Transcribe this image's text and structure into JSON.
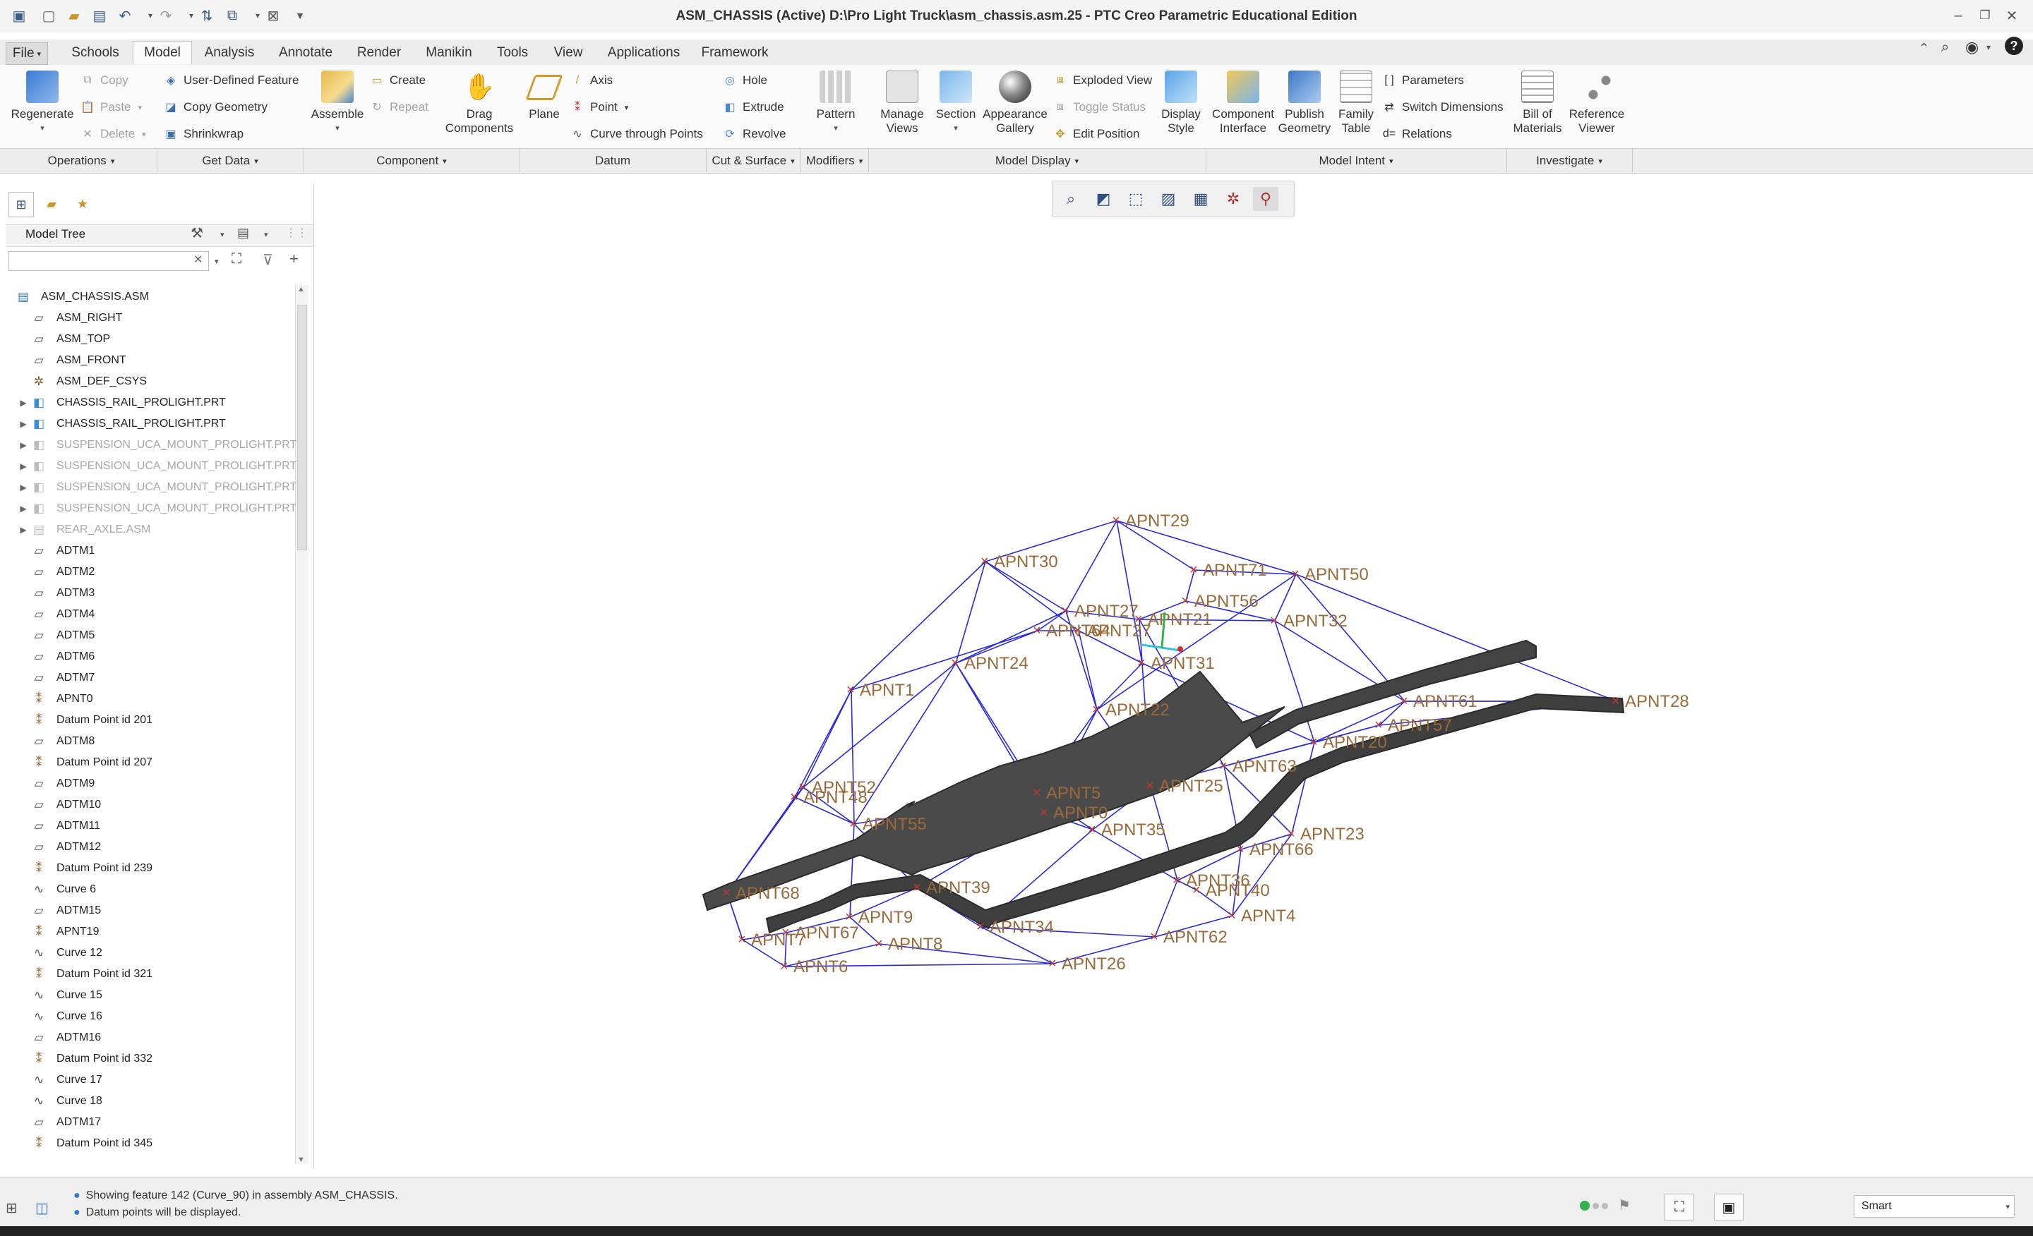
{
  "window": {
    "title": "ASM_CHASSIS (Active) D:\\Pro Light Truck\\asm_chassis.asm.25 - PTC Creo Parametric Educational Edition"
  },
  "tabs": [
    "File",
    "Schools",
    "Model",
    "Analysis",
    "Annotate",
    "Render",
    "Manikin",
    "Tools",
    "View",
    "Applications",
    "Framework"
  ],
  "active_tab": "Model",
  "ribbon": {
    "regenerate": "Regenerate",
    "copy": "Copy",
    "paste": "Paste",
    "delete": "Delete",
    "user_defined_feature": "User-Defined Feature",
    "copy_geometry": "Copy Geometry",
    "shrinkwrap": "Shrinkwrap",
    "assemble": "Assemble",
    "create": "Create",
    "repeat": "Repeat",
    "drag_components_1": "Drag",
    "drag_components_2": "Components",
    "plane": "Plane",
    "axis": "Axis",
    "point": "Point",
    "curve_through_points": "Curve through Points",
    "hole": "Hole",
    "extrude": "Extrude",
    "revolve": "Revolve",
    "pattern": "Pattern",
    "manage_views_1": "Manage",
    "manage_views_2": "Views",
    "section": "Section",
    "appearance_gallery_1": "Appearance",
    "appearance_gallery_2": "Gallery",
    "exploded_view": "Exploded View",
    "toggle_status": "Toggle Status",
    "edit_position": "Edit Position",
    "display_style_1": "Display",
    "display_style_2": "Style",
    "component_interface_1": "Component",
    "component_interface_2": "Interface",
    "publish_geometry_1": "Publish",
    "publish_geometry_2": "Geometry",
    "family_table_1": "Family",
    "family_table_2": "Table",
    "parameters": "Parameters",
    "switch_dimensions": "Switch Dimensions",
    "relations": "Relations",
    "bill_of_materials_1": "Bill of",
    "bill_of_materials_2": "Materials",
    "reference_viewer_1": "Reference",
    "reference_viewer_2": "Viewer",
    "groups": [
      "Operations",
      "Get Data",
      "Component",
      "Datum",
      "Cut & Surface",
      "Modifiers",
      "Model Display",
      "Model Intent",
      "Investigate"
    ]
  },
  "model_tree": {
    "title": "Model Tree",
    "search_placeholder": "",
    "items": [
      {
        "label": "ASM_CHASSIS.ASM",
        "icon": "assembly-icon",
        "expandable": false,
        "greyed": false,
        "root": true
      },
      {
        "label": "ASM_RIGHT",
        "icon": "datum-plane-icon",
        "expandable": false,
        "greyed": false
      },
      {
        "label": "ASM_TOP",
        "icon": "datum-plane-icon",
        "expandable": false,
        "greyed": false
      },
      {
        "label": "ASM_FRONT",
        "icon": "datum-plane-icon",
        "expandable": false,
        "greyed": false
      },
      {
        "label": "ASM_DEF_CSYS",
        "icon": "csys-icon",
        "expandable": false,
        "greyed": false
      },
      {
        "label": "CHASSIS_RAIL_PROLIGHT.PRT",
        "icon": "part-icon",
        "expandable": true,
        "greyed": false
      },
      {
        "label": "CHASSIS_RAIL_PROLIGHT.PRT",
        "icon": "part-icon",
        "expandable": true,
        "greyed": false
      },
      {
        "label": "SUSPENSION_UCA_MOUNT_PROLIGHT.PRT",
        "icon": "part-icon",
        "expandable": true,
        "greyed": true
      },
      {
        "label": "SUSPENSION_UCA_MOUNT_PROLIGHT.PRT",
        "icon": "part-icon",
        "expandable": true,
        "greyed": true
      },
      {
        "label": "SUSPENSION_UCA_MOUNT_PROLIGHT.PRT",
        "icon": "part-icon",
        "expandable": true,
        "greyed": true
      },
      {
        "label": "SUSPENSION_UCA_MOUNT_PROLIGHT.PRT",
        "icon": "part-icon",
        "expandable": true,
        "greyed": true
      },
      {
        "label": "REAR_AXLE.ASM",
        "icon": "assembly-icon",
        "expandable": true,
        "greyed": true
      },
      {
        "label": "ADTM1",
        "icon": "datum-plane-icon",
        "expandable": false,
        "greyed": false
      },
      {
        "label": "ADTM2",
        "icon": "datum-plane-icon",
        "expandable": false,
        "greyed": false
      },
      {
        "label": "ADTM3",
        "icon": "datum-plane-icon",
        "expandable": false,
        "greyed": false
      },
      {
        "label": "ADTM4",
        "icon": "datum-plane-icon",
        "expandable": false,
        "greyed": false
      },
      {
        "label": "ADTM5",
        "icon": "datum-plane-icon",
        "expandable": false,
        "greyed": false
      },
      {
        "label": "ADTM6",
        "icon": "datum-plane-icon",
        "expandable": false,
        "greyed": false
      },
      {
        "label": "ADTM7",
        "icon": "datum-plane-icon",
        "expandable": false,
        "greyed": false
      },
      {
        "label": "APNT0",
        "icon": "datum-point-icon",
        "expandable": false,
        "greyed": false
      },
      {
        "label": "Datum Point id 201",
        "icon": "datum-point-icon",
        "expandable": false,
        "greyed": false
      },
      {
        "label": "ADTM8",
        "icon": "datum-plane-icon",
        "expandable": false,
        "greyed": false
      },
      {
        "label": "Datum Point id 207",
        "icon": "datum-point-icon",
        "expandable": false,
        "greyed": false
      },
      {
        "label": "ADTM9",
        "icon": "datum-plane-icon",
        "expandable": false,
        "greyed": false
      },
      {
        "label": "ADTM10",
        "icon": "datum-plane-icon",
        "expandable": false,
        "greyed": false
      },
      {
        "label": "ADTM11",
        "icon": "datum-plane-icon",
        "expandable": false,
        "greyed": false
      },
      {
        "label": "ADTM12",
        "icon": "datum-plane-icon",
        "expandable": false,
        "greyed": false
      },
      {
        "label": "Datum Point id 239",
        "icon": "datum-point-icon",
        "expandable": false,
        "greyed": false
      },
      {
        "label": "Curve 6",
        "icon": "curve-icon",
        "expandable": false,
        "greyed": false
      },
      {
        "label": "ADTM15",
        "icon": "datum-plane-icon",
        "expandable": false,
        "greyed": false
      },
      {
        "label": "APNT19",
        "icon": "datum-point-icon",
        "expandable": false,
        "greyed": false
      },
      {
        "label": "Curve 12",
        "icon": "curve-icon",
        "expandable": false,
        "greyed": false
      },
      {
        "label": "Datum Point id 321",
        "icon": "datum-point-icon",
        "expandable": false,
        "greyed": false
      },
      {
        "label": "Curve 15",
        "icon": "curve-icon",
        "expandable": false,
        "greyed": false
      },
      {
        "label": "Curve 16",
        "icon": "curve-icon",
        "expandable": false,
        "greyed": false
      },
      {
        "label": "ADTM16",
        "icon": "datum-plane-icon",
        "expandable": false,
        "greyed": false
      },
      {
        "label": "Datum Point id 332",
        "icon": "datum-point-icon",
        "expandable": false,
        "greyed": false
      },
      {
        "label": "Curve 17",
        "icon": "curve-icon",
        "expandable": false,
        "greyed": false
      },
      {
        "label": "Curve 18",
        "icon": "curve-icon",
        "expandable": false,
        "greyed": false
      },
      {
        "label": "ADTM17",
        "icon": "datum-plane-icon",
        "expandable": false,
        "greyed": false
      },
      {
        "label": "Datum Point id 345",
        "icon": "datum-point-icon",
        "expandable": false,
        "greyed": false
      }
    ]
  },
  "viewport": {
    "points": [
      "APNT29",
      "APNT30",
      "APNT71",
      "APNT50",
      "APNT56",
      "APNT27",
      "APNT21",
      "APNT32",
      "APNT64",
      "APNT27",
      "APNT31",
      "APNT1",
      "APNT24",
      "APNT22",
      "APNT61",
      "APNT28",
      "APNT57",
      "APNT20",
      "APNT63",
      "APNT52",
      "APNT48",
      "APNT5",
      "APNT0",
      "APNT25",
      "APNT55",
      "APNT35",
      "APNT23",
      "APNT66",
      "APNT36",
      "APNT40",
      "APNT39",
      "APNT9",
      "APNT34",
      "APNT4",
      "APNT67",
      "APNT7",
      "APNT8",
      "APNT62",
      "APNT6",
      "APNT26",
      "APNT68"
    ],
    "colors": {
      "wire": "#2a2ad6",
      "point_marker": "#c0392b",
      "label": "#9a6a3a",
      "rail_dark": "#3c3c3c",
      "rail_light": "#7a7a7a"
    }
  },
  "status": {
    "message_1": "Showing feature 142 (Curve_90) in assembly ASM_CHASSIS.",
    "message_2": "Datum points will be displayed.",
    "selection_filter": "Smart"
  }
}
